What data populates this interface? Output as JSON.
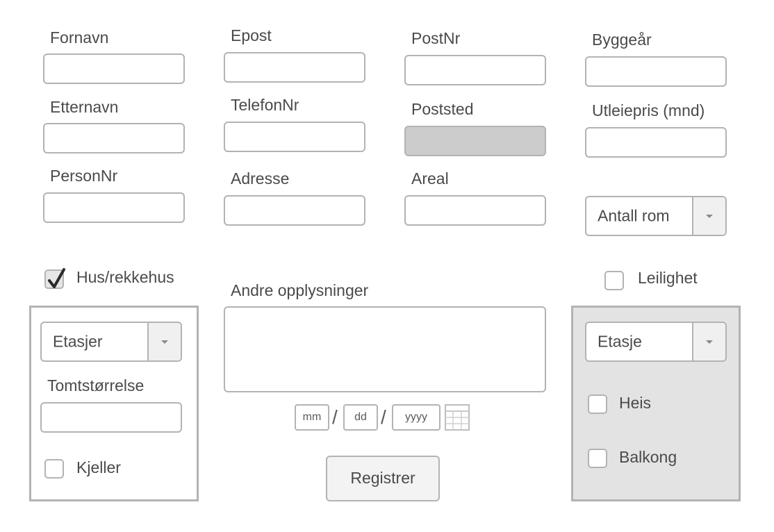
{
  "col1": {
    "first_name_label": "Fornavn",
    "last_name_label": "Etternavn",
    "person_nr_label": "PersonNr"
  },
  "col2": {
    "email_label": "Epost",
    "phone_label": "TelefonNr",
    "address_label": "Adresse"
  },
  "col3": {
    "postnr_label": "PostNr",
    "poststed_label": "Poststed",
    "areal_label": "Areal"
  },
  "col4": {
    "build_year_label": "Byggeår",
    "rent_label": "Utleiepris (mnd)",
    "rooms_select": "Antall rom"
  },
  "house": {
    "checkbox_label": "Hus/rekkehus",
    "checked": true,
    "floors_select": "Etasjer",
    "lot_size_label": "Tomtstørrelse",
    "basement_label": "Kjeller"
  },
  "middle": {
    "other_info_label": "Andre opplysninger",
    "date_mm": "mm",
    "date_dd": "dd",
    "date_yyyy": "yyyy",
    "date_sep": "/",
    "register_button": "Registrer"
  },
  "apartment": {
    "checkbox_label": "Leilighet",
    "checked": false,
    "floor_select": "Etasje",
    "elevator_label": "Heis",
    "balcony_label": "Balkong"
  }
}
